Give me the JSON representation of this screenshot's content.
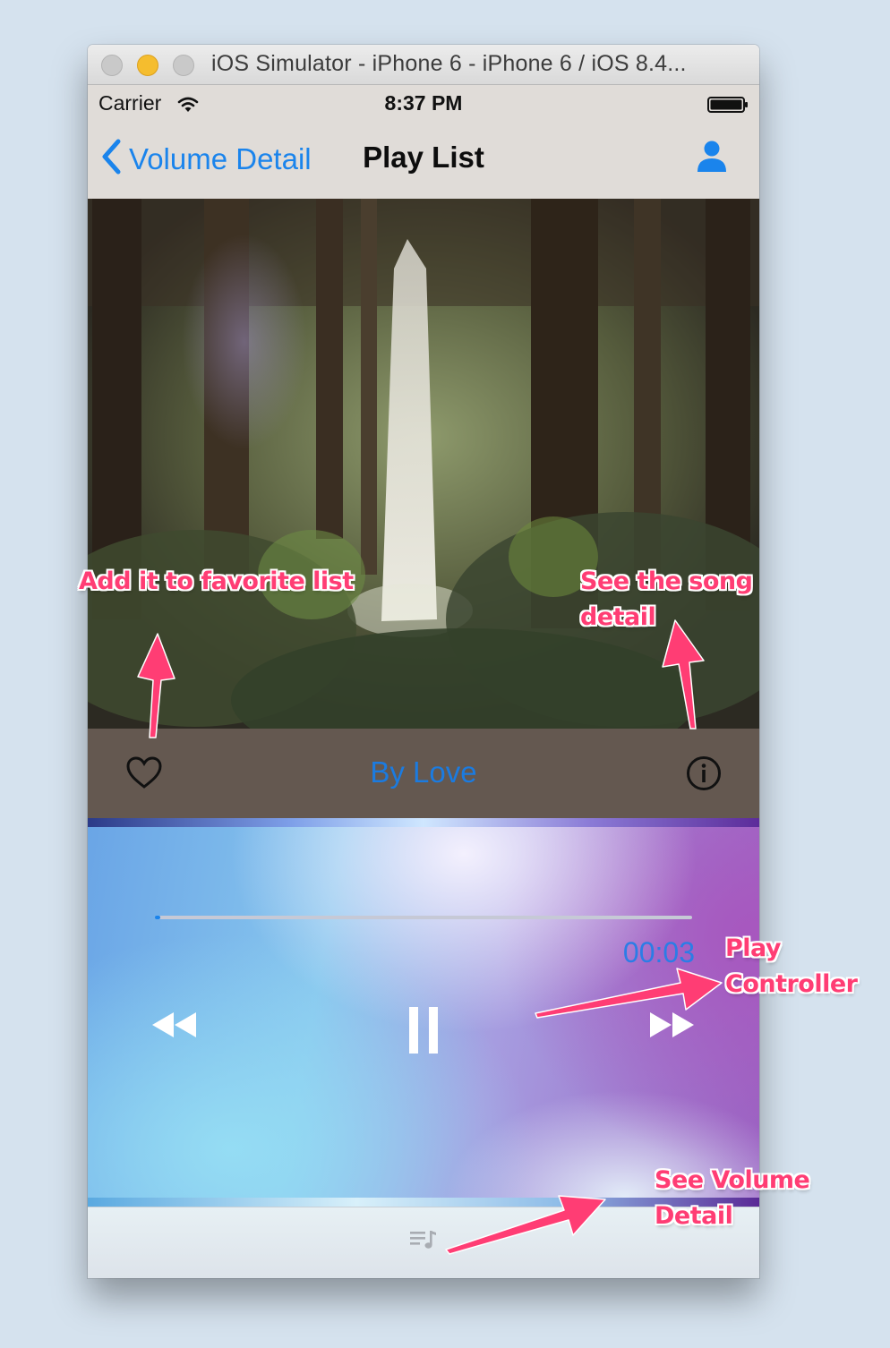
{
  "window": {
    "title": "iOS Simulator - iPhone 6 - iPhone 6 / iOS 8.4..."
  },
  "status_bar": {
    "carrier": "Carrier",
    "time": "8:37 PM"
  },
  "nav": {
    "back_label": "Volume Detail",
    "title": "Play List"
  },
  "song": {
    "title": "By Love"
  },
  "player": {
    "elapsed": "00:03",
    "progress_fraction": 0.01
  },
  "annotations": {
    "favorite_lines": [
      "Add it to favorite list"
    ],
    "song_detail_lines": [
      "See the song",
      "detail"
    ],
    "play_controller_lines": [
      "Play",
      "Controller"
    ],
    "volume_detail_lines": [
      "See Volume",
      "Detail"
    ]
  },
  "colors": {
    "ios_blue": "#1a84ec",
    "annotation_pink": "#ff3d74",
    "song_bar": "#645850"
  },
  "icons": {
    "wifi": "wifi-icon",
    "battery": "battery-icon",
    "back": "chevron-left-icon",
    "user": "person-icon",
    "favorite": "heart-icon",
    "info": "info-icon",
    "rewind": "rewind-icon",
    "pause": "pause-icon",
    "forward": "fast-forward-icon",
    "playlist": "playlist-icon"
  }
}
